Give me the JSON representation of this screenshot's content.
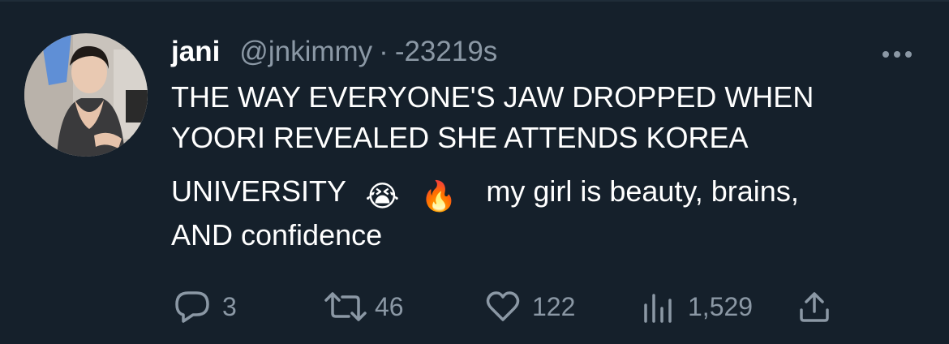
{
  "tweet": {
    "author": {
      "display_name": "jani",
      "handle": "@jnkimmy",
      "separator": "·",
      "time": "-23219s"
    },
    "text_lines": [
      "THE WAY EVERYONE'S JAW DROPPED WHEN",
      "YOORI REVEALED SHE ATTENDS KOREA",
      "UNIVERSITY",
      "my girl is beauty, brains,",
      "AND confidence"
    ],
    "emojis": [
      "😭",
      "🔥"
    ],
    "actions": {
      "replies": "3",
      "retweets": "46",
      "likes": "122",
      "views": "1,529"
    }
  },
  "icons": {
    "more": "more-dots-icon",
    "reply": "reply-bubble-icon",
    "retweet": "retweet-icon",
    "like": "heart-icon",
    "views": "views-bar-chart-icon",
    "share": "share-upload-icon"
  },
  "colors": {
    "background": "#15202b",
    "text": "#ffffff",
    "muted": "#8b98a5"
  }
}
